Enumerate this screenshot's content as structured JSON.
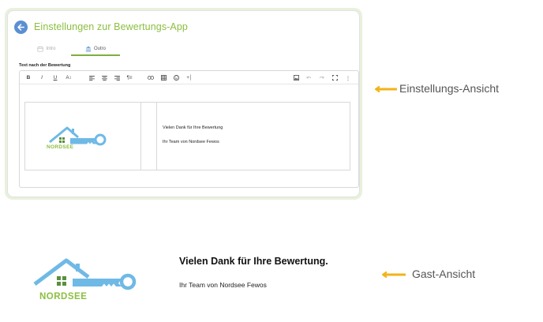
{
  "settings_view": {
    "title": "Einstellungen zur Bewertungs-App",
    "tabs": [
      {
        "label": "Intro",
        "active": false
      },
      {
        "label": "Outro",
        "active": true
      }
    ],
    "field_label": "Text nach der Bewertung",
    "toolbar": {
      "bold": "B",
      "italic": "I",
      "underline": "U",
      "text_size": "A↕",
      "paragraph": "¶≡",
      "insert": "+│",
      "more": "⋮"
    },
    "editor_content": {
      "logo_text": "NORDSEE",
      "line1": "Vielen Dank für Ihre Bewertung",
      "line2": "Ihr Team von Nordsee Fewos"
    }
  },
  "guest_view": {
    "logo_text": "NORDSEE",
    "heading": "Vielen Dank für Ihre Bewertung.",
    "subtext": "Ihr Team von Nordsee Fewos"
  },
  "annotations": {
    "settings_label": "Einstellungs-Ansicht",
    "guest_label": "Gast-Ansicht"
  },
  "colors": {
    "accent_green": "#8bbf3f",
    "back_button_blue": "#5b8fd4",
    "logo_blue": "#6fb9e6",
    "logo_green": "#8bbf3f",
    "arrow_orange": "#f2b318"
  }
}
